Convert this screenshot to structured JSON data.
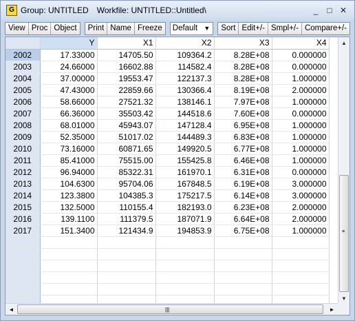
{
  "window": {
    "icon_letter": "G",
    "title_group": "Group: UNTITLED",
    "title_workfile": "Workfile: UNTITLED::Untitled\\"
  },
  "window_controls": {
    "minimize": "_",
    "maximize": "□",
    "close": "✕"
  },
  "toolbar": {
    "group1": [
      "View",
      "Proc",
      "Object"
    ],
    "group2": [
      "Print",
      "Name",
      "Freeze"
    ],
    "dropdown_value": "Default",
    "group3": [
      "Sort",
      "Edit+/-",
      "Smpl+/-",
      "Compare+/-"
    ]
  },
  "table": {
    "columns": [
      "Y",
      "X1",
      "X2",
      "X3",
      "X4"
    ],
    "rows": [
      {
        "obs": "2002",
        "cells": [
          "17.33000",
          "14705.50",
          "109364.2",
          "8.28E+08",
          "0.000000"
        ]
      },
      {
        "obs": "2003",
        "cells": [
          "24.66000",
          "16602.88",
          "114582.4",
          "8.28E+08",
          "0.000000"
        ]
      },
      {
        "obs": "2004",
        "cells": [
          "37.00000",
          "19553.47",
          "122137.3",
          "8.28E+08",
          "1.000000"
        ]
      },
      {
        "obs": "2005",
        "cells": [
          "47.43000",
          "22859.66",
          "130366.4",
          "8.19E+08",
          "2.000000"
        ]
      },
      {
        "obs": "2006",
        "cells": [
          "58.66000",
          "27521.32",
          "138146.1",
          "7.97E+08",
          "1.000000"
        ]
      },
      {
        "obs": "2007",
        "cells": [
          "66.36000",
          "35503.42",
          "144518.6",
          "7.60E+08",
          "0.000000"
        ]
      },
      {
        "obs": "2008",
        "cells": [
          "68.01000",
          "45943.07",
          "147128.4",
          "6.95E+08",
          "1.000000"
        ]
      },
      {
        "obs": "2009",
        "cells": [
          "52.35000",
          "51017.02",
          "144489.3",
          "6.83E+08",
          "1.000000"
        ]
      },
      {
        "obs": "2010",
        "cells": [
          "73.16000",
          "60871.65",
          "149920.5",
          "6.77E+08",
          "1.000000"
        ]
      },
      {
        "obs": "2011",
        "cells": [
          "85.41000",
          "75515.00",
          "155425.8",
          "6.46E+08",
          "1.000000"
        ]
      },
      {
        "obs": "2012",
        "cells": [
          "96.94000",
          "85322.31",
          "161970.1",
          "6.31E+08",
          "0.000000"
        ]
      },
      {
        "obs": "2013",
        "cells": [
          "104.6300",
          "95704.06",
          "167848.5",
          "6.19E+08",
          "3.000000"
        ]
      },
      {
        "obs": "2014",
        "cells": [
          "123.3800",
          "104385.3",
          "175217.5",
          "6.14E+08",
          "3.000000"
        ]
      },
      {
        "obs": "2015",
        "cells": [
          "132.5000",
          "110155.4",
          "182193.0",
          "6.23E+08",
          "2.000000"
        ]
      },
      {
        "obs": "2016",
        "cells": [
          "139.1100",
          "111379.5",
          "187071.9",
          "6.64E+08",
          "2.000000"
        ]
      },
      {
        "obs": "2017",
        "cells": [
          "151.3400",
          "121434.9",
          "194853.9",
          "6.75E+08",
          "1.000000"
        ]
      }
    ]
  },
  "scroll": {
    "up": "▲",
    "down": "▼",
    "left": "◄",
    "right": "►",
    "grip_v": "≡",
    "grip_h": "|||"
  }
}
